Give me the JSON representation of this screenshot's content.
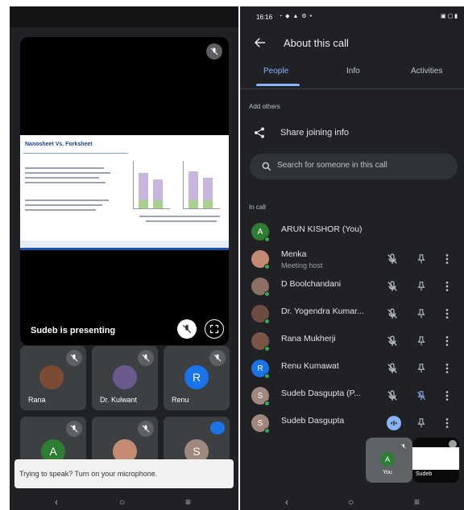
{
  "left": {
    "presenter_label": "Sudeb is presenting",
    "slide": {
      "title": "Nanosheet Vs. Forksheet"
    },
    "tiles": [
      {
        "name": "Rana",
        "avatar_type": "photo"
      },
      {
        "name": "Dr. Kulwant",
        "avatar_type": "photo"
      },
      {
        "name": "Renu",
        "avatar_letter": "R",
        "avatar_color": "#1a73e8"
      },
      {
        "name": "",
        "avatar_letter": "A",
        "avatar_color": "#2d7d32"
      },
      {
        "name": "",
        "avatar_type": "photo"
      },
      {
        "name": "",
        "avatar_letter": "S",
        "avatar_color": "#a1887f"
      }
    ],
    "toast": "Trying to speak? Turn on your microphone."
  },
  "right": {
    "status": {
      "time": "16:16"
    },
    "header": {
      "title": "About this call"
    },
    "tabs": [
      {
        "label": "People",
        "active": true
      },
      {
        "label": "Info",
        "active": false
      },
      {
        "label": "Activities",
        "active": false
      }
    ],
    "add_others_label": "Add others",
    "share_label": "Share joining info",
    "search_placeholder": "Search for someone in this call",
    "in_call_label": "In call",
    "participants": [
      {
        "name": "ARUN KISHOR (You)",
        "subtitle": "",
        "avatar_letter": "A",
        "avatar_color": "#2d7d32",
        "controls": false
      },
      {
        "name": "Menka",
        "subtitle": "Meeting host",
        "avatar_letter": "",
        "avatar_color": "#c48b72",
        "controls": true,
        "mic": "off"
      },
      {
        "name": "D Boolchandani",
        "subtitle": "",
        "avatar_letter": "",
        "avatar_color": "#8d6e63",
        "controls": true,
        "mic": "off"
      },
      {
        "name": "Dr. Yogendra Kumar...",
        "subtitle": "",
        "avatar_letter": "",
        "avatar_color": "#6d4c41",
        "controls": true,
        "mic": "off"
      },
      {
        "name": "Rana Mukherji",
        "subtitle": "",
        "avatar_letter": "",
        "avatar_color": "#795548",
        "controls": true,
        "mic": "off"
      },
      {
        "name": "Renu Kumawat",
        "subtitle": "",
        "avatar_letter": "R",
        "avatar_color": "#1a73e8",
        "controls": true,
        "mic": "off"
      },
      {
        "name": "Sudeb Dasgupta (P...",
        "subtitle": "",
        "avatar_letter": "S",
        "avatar_color": "#a1887f",
        "controls": true,
        "mic": "off",
        "pin_highlight": true
      },
      {
        "name": "Sudeb Dasgupta",
        "subtitle": "",
        "avatar_letter": "S",
        "avatar_color": "#a1887f",
        "controls": true,
        "mic": "speaking"
      }
    ],
    "self_view": {
      "label": "You",
      "avatar_letter": "A"
    },
    "pip_label": "Sudeb"
  },
  "colors": {
    "background": "#1f2124",
    "accent": "#8ab4f8",
    "tile": "#3c4043"
  }
}
